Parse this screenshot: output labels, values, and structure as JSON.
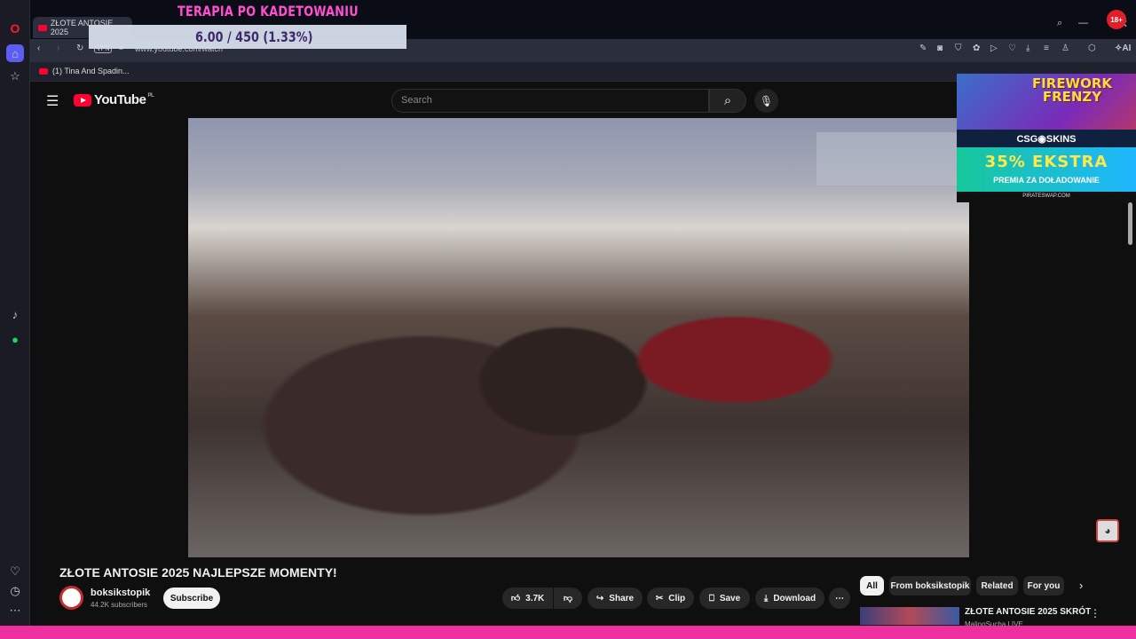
{
  "overlay": {
    "title": "TERAPIA PO KADETOWANIU",
    "counter": "6.00 / 450 (1.33%)",
    "badge": "18+"
  },
  "browser": {
    "tab_title": "ZŁOTE ANTOSIE 2025",
    "vpn": "VPN",
    "url": "www.youtube.com/watch",
    "bookmark": "(1) Tina And Spadin...",
    "ai_label": "AI"
  },
  "youtube": {
    "logo": "YouTube",
    "region": "PL",
    "search_placeholder": "Search",
    "video_title": "ZŁOTE ANTOSIE 2025 NAJLEPSZE MOMENTY!",
    "channel": "boksikstopik",
    "subscribers": "44.2K subscribers",
    "subscribe": "Subscribe",
    "likes": "3.7K",
    "share": "Share",
    "clip": "Clip",
    "save": "Save",
    "download": "Download",
    "chips": [
      "All",
      "From boksikstopik",
      "Related",
      "For you"
    ],
    "rec_title": "ZŁOTE ANTOSIE 2025 SKRÓT",
    "rec_channel": "MalinoSucha LIVE"
  },
  "ad": {
    "game": "FIREWORK FRENZY",
    "brand": "CSG◉SKINS",
    "promo": "35% EKSTRA",
    "promo_sub": "PREMIA ZA DOŁADOWANIE",
    "footer": "PIRATESWAP.COM"
  }
}
